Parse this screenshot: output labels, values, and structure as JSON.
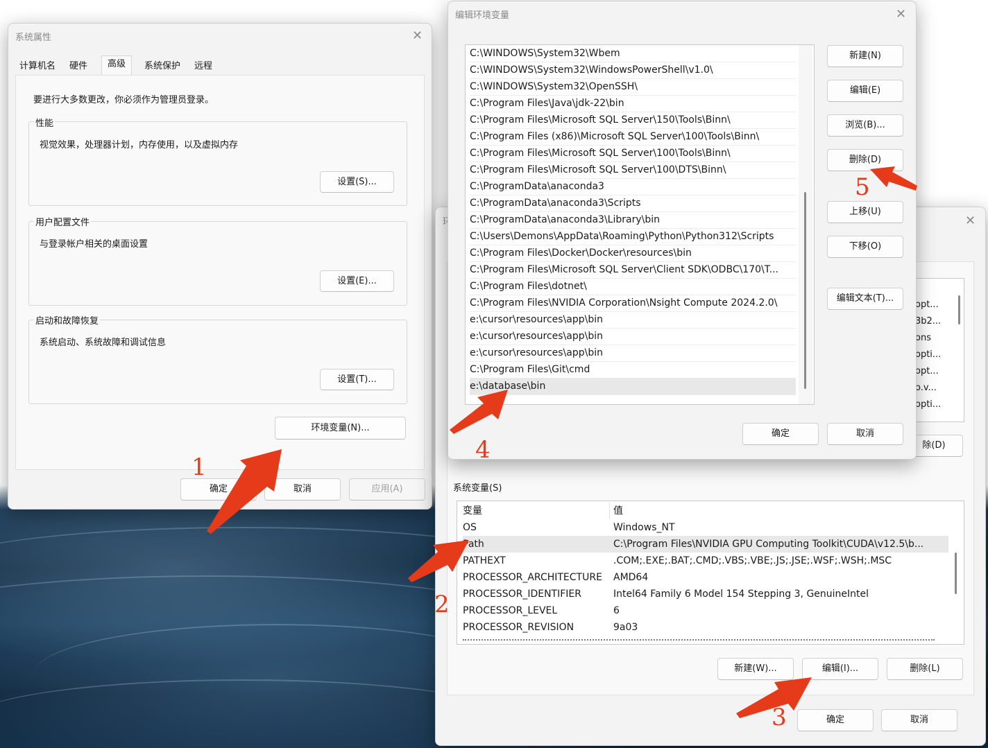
{
  "system_properties": {
    "title": "系统属性",
    "close_glyph": "✕",
    "tabs": [
      "计算机名",
      "硬件",
      "高级",
      "系统保护",
      "远程"
    ],
    "notice": "要进行大多数更改，你必须作为管理员登录。",
    "performance": {
      "label": "性能",
      "desc": "视觉效果，处理器计划，内存使用，以及虚拟内存",
      "button": "设置(S)..."
    },
    "user_profiles": {
      "label": "用户配置文件",
      "desc": "与登录帐户相关的桌面设置",
      "button": "设置(E)..."
    },
    "startup_recovery": {
      "label": "启动和故障恢复",
      "desc": "系统启动、系统故障和调试信息",
      "button": "设置(T)..."
    },
    "env_button": "环境变量(N)...",
    "ok": "确定",
    "cancel": "取消",
    "apply": "应用(A)"
  },
  "env_vars": {
    "title": "环",
    "close_glyph": "✕",
    "user_rows_partial": [
      "opt...",
      "3b2...",
      "ons",
      "opti...",
      "opt...",
      "o.v...",
      "opti..."
    ],
    "user_delete_partial": "除(D)",
    "system_label": "系统变量(S)",
    "col_var": "变量",
    "col_val": "值",
    "rows": [
      {
        "name": "OS",
        "value": "Windows_NT"
      },
      {
        "name": "Path",
        "value": "C:\\Program Files\\NVIDIA GPU Computing Toolkit\\CUDA\\v12.5\\b..."
      },
      {
        "name": "PATHEXT",
        "value": ".COM;.EXE;.BAT;.CMD;.VBS;.VBE;.JS;.JSE;.WSF;.WSH;.MSC"
      },
      {
        "name": "PROCESSOR_ARCHITECTURE",
        "value": "AMD64"
      },
      {
        "name": "PROCESSOR_IDENTIFIER",
        "value": "Intel64 Family 6 Model 154 Stepping 3, GenuineIntel"
      },
      {
        "name": "PROCESSOR_LEVEL",
        "value": "6"
      },
      {
        "name": "PROCESSOR_REVISION",
        "value": "9a03"
      }
    ],
    "selected_row": 1,
    "new_button": "新建(W)...",
    "edit_button": "编辑(I)...",
    "delete_button": "删除(L)",
    "ok": "确定",
    "cancel": "取消"
  },
  "edit_env": {
    "title": "编辑环境变量",
    "close_glyph": "✕",
    "paths": [
      "C:\\WINDOWS\\System32\\Wbem",
      "C:\\WINDOWS\\System32\\WindowsPowerShell\\v1.0\\",
      "C:\\WINDOWS\\System32\\OpenSSH\\",
      "C:\\Program Files\\Java\\jdk-22\\bin",
      "C:\\Program Files\\Microsoft SQL Server\\150\\Tools\\Binn\\",
      "C:\\Program Files (x86)\\Microsoft SQL Server\\100\\Tools\\Binn\\",
      "C:\\Program Files\\Microsoft SQL Server\\100\\Tools\\Binn\\",
      "C:\\Program Files\\Microsoft SQL Server\\100\\DTS\\Binn\\",
      "C:\\ProgramData\\anaconda3",
      "C:\\ProgramData\\anaconda3\\Scripts",
      "C:\\ProgramData\\anaconda3\\Library\\bin",
      "C:\\Users\\Demons\\AppData\\Roaming\\Python\\Python312\\Scripts",
      "C:\\Program Files\\Docker\\Docker\\resources\\bin",
      "C:\\Program Files\\Microsoft SQL Server\\Client SDK\\ODBC\\170\\T...",
      "C:\\Program Files\\dotnet\\",
      "C:\\Program Files\\NVIDIA Corporation\\Nsight Compute 2024.2.0\\",
      "e:\\cursor\\resources\\app\\bin",
      "e:\\cursor\\resources\\app\\bin",
      "e:\\cursor\\resources\\app\\bin",
      "C:\\Program Files\\Git\\cmd",
      "e:\\database\\bin"
    ],
    "selected_path": 20,
    "buttons": {
      "new": "新建(N)",
      "edit": "编辑(E)",
      "browse": "浏览(B)...",
      "delete": "删除(D)",
      "move_up": "上移(U)",
      "move_down": "下移(O)",
      "edit_text": "编辑文本(T)..."
    },
    "ok": "确定",
    "cancel": "取消"
  },
  "annotations": {
    "color": "#e53b1a",
    "markers": [
      "1",
      "2",
      "3",
      "4",
      "5"
    ]
  }
}
